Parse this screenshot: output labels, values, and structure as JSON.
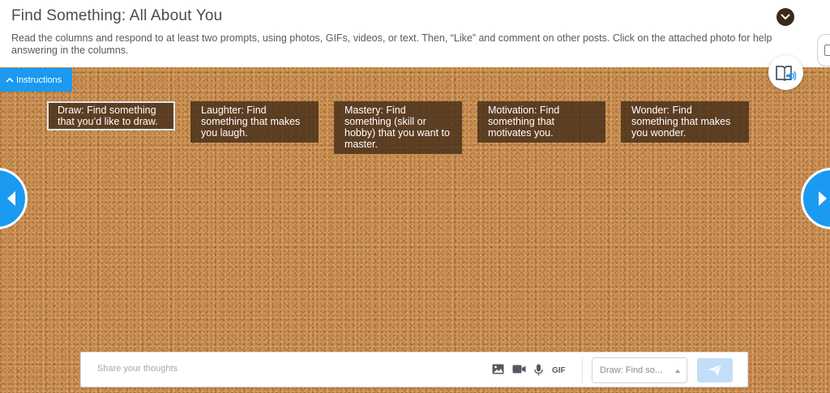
{
  "header": {
    "title": "Find Something: All About You",
    "description": "Read the columns and respond to at least two prompts, using photos, GIFs, videos, or text. Then, “Like” and comment on other posts. Click on the attached photo for help answering in the columns."
  },
  "instructions": {
    "label": "Instructions"
  },
  "columns": [
    {
      "label": "Draw: Find something that you’d like to draw.",
      "active": true
    },
    {
      "label": "Laughter: Find something that makes you laugh.",
      "active": false
    },
    {
      "label": "Mastery: Find something (skill or hobby) that you want to master.",
      "active": false
    },
    {
      "label": "Motivation: Find something that motivates you.",
      "active": false
    },
    {
      "label": "Wonder: Find something that makes you wonder.",
      "active": false
    }
  ],
  "composer": {
    "placeholder": "Share your thoughts",
    "gif_label": "GIF",
    "column_select": "Draw: Find so..."
  },
  "colors": {
    "accent": "#1a9af0",
    "cork": "#c98f52",
    "column_bg": "#462d19",
    "send_disabled": "#c3def8"
  },
  "icons": [
    "chevron-down-icon",
    "document-icon",
    "chevron-up-icon",
    "read-aloud-icon",
    "arrow-left-icon",
    "arrow-right-icon",
    "image-icon",
    "video-icon",
    "microphone-icon",
    "send-icon"
  ]
}
